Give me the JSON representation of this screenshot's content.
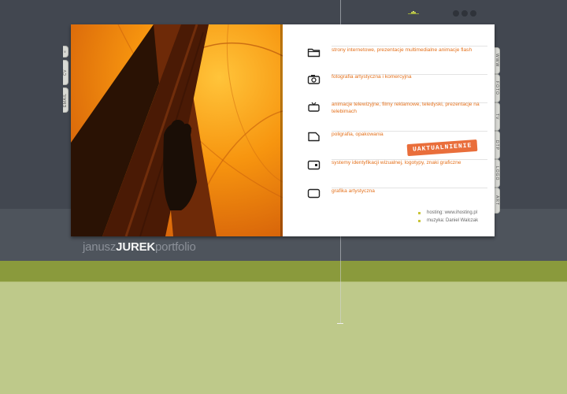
{
  "left_tabs": [
    {
      "label": "«"
    },
    {
      "label": "CV"
    },
    {
      "label": "EMAIL"
    }
  ],
  "right_tabs": [
    {
      "label": "WWW"
    },
    {
      "label": "FOTO"
    },
    {
      "label": "TV"
    },
    {
      "label": "DTP"
    },
    {
      "label": "LOGO"
    },
    {
      "label": "ART"
    }
  ],
  "menu": [
    {
      "icon": "folder-icon",
      "label": "strony internetowe, prezentacje multimedialne animacje flash"
    },
    {
      "icon": "camera-icon",
      "label": "fotografia artystyczna i komercyjna"
    },
    {
      "icon": "tv-icon",
      "label": "animacje telewizyjne, filmy reklamowe, teledyski, prezentacje na telebimach"
    },
    {
      "icon": "document-icon",
      "label": "poligrafia, opakowania"
    },
    {
      "icon": "id-card-icon",
      "label": "systemy identyfikacji wizualnej, logotypy, znaki graficzne"
    },
    {
      "icon": "frame-icon",
      "label": "grafika artystyczna"
    }
  ],
  "stamp": {
    "text": "UAKTUALNIENIE"
  },
  "credits": [
    {
      "text": "hosting: www.ihosting.pl"
    },
    {
      "text": "muzyka: Daniel Walczak"
    }
  ],
  "logo": {
    "first": "janusz",
    "last": "JUREK",
    "suffix": "portfolio"
  },
  "colors": {
    "accent": "#e4711c",
    "background_top": "#424750",
    "band_olive": "#8a9a3c",
    "background_bottom": "#bec98a"
  }
}
